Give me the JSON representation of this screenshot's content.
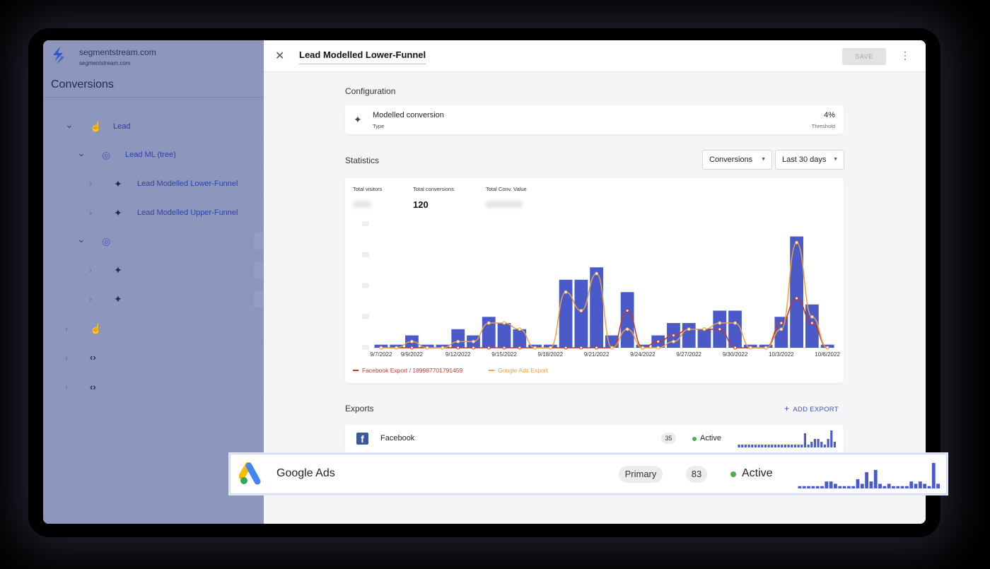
{
  "sidebar": {
    "site_name": "segmentstream.com",
    "site_sub": "segmentstream.com",
    "heading": "Conversions",
    "tree": [
      {
        "label": "Lead",
        "icon": "hand-pointer-icon",
        "level": 0,
        "chevron": "down"
      },
      {
        "label": "Lead ML (tree)",
        "icon": "ml-target-icon",
        "level": 1,
        "chevron": "down"
      },
      {
        "label": "Lead Modelled Lower-Funnel",
        "icon": "sparkle-icon",
        "level": 2,
        "chevron": "right"
      },
      {
        "label": "Lead Modelled Upper-Funnel",
        "icon": "sparkle-icon",
        "level": 2,
        "chevron": "right"
      },
      {
        "label": "",
        "icon": "ml-target-icon",
        "level": 1,
        "chevron": "down"
      },
      {
        "label": "",
        "icon": "sparkle-icon",
        "level": 2,
        "chevron": "right"
      },
      {
        "label": "",
        "icon": "sparkle-icon",
        "level": 2,
        "chevron": "right"
      },
      {
        "label": "",
        "icon": "hand-pointer-icon",
        "level": 0,
        "chevron": "right"
      },
      {
        "label": "",
        "icon": "code-icon",
        "level": 0,
        "chevron": "right"
      },
      {
        "label": "",
        "icon": "code-icon",
        "level": 0,
        "chevron": "right"
      }
    ]
  },
  "panel": {
    "title": "Lead Modelled Lower-Funnel",
    "save_label": "SAVE",
    "close_icon": "close-icon",
    "more_icon": "more-vertical-icon"
  },
  "configuration": {
    "section_title": "Configuration",
    "name": "Modelled conversion",
    "type_label": "Type",
    "value": "4%",
    "value_label": "Threshold"
  },
  "statistics": {
    "section_title": "Statistics",
    "metric_select": "Conversions",
    "range_select": "Last 30 days",
    "kpis": [
      {
        "label": "Total visitors",
        "value": ""
      },
      {
        "label": "Total conversions",
        "value": "120"
      },
      {
        "label": "Total Conv. Value",
        "value": ""
      }
    ]
  },
  "chart_data": {
    "type": "bar",
    "title": "",
    "xlabel": "",
    "ylabel": "",
    "categories": [
      "9/7/2022",
      "9/8/2022",
      "9/9/2022",
      "9/10/2022",
      "9/11/2022",
      "9/12/2022",
      "9/13/2022",
      "9/14/2022",
      "9/15/2022",
      "9/16/2022",
      "9/17/2022",
      "9/18/2022",
      "9/19/2022",
      "9/20/2022",
      "9/21/2022",
      "9/22/2022",
      "9/23/2022",
      "9/24/2022",
      "9/25/2022",
      "9/26/2022",
      "9/27/2022",
      "9/28/2022",
      "9/29/2022",
      "9/30/2022",
      "10/1/2022",
      "10/2/2022",
      "10/3/2022",
      "10/4/2022",
      "10/5/2022",
      "10/6/2022"
    ],
    "tick_labels": [
      "9/7/2022",
      "9/9/2022",
      "9/12/2022",
      "9/15/2022",
      "9/18/2022",
      "9/21/2022",
      "9/24/2022",
      "9/27/2022",
      "9/30/2022",
      "10/3/2022",
      "10/6/2022"
    ],
    "ylim": [
      0,
      20
    ],
    "series": [
      {
        "kind": "bar",
        "color": "#4a5bc9",
        "values": [
          0.5,
          0.5,
          2,
          0.5,
          0.5,
          3,
          2,
          5,
          4,
          3,
          0.5,
          0.5,
          11,
          11,
          13,
          2,
          9,
          0.5,
          2,
          4,
          4,
          3,
          6,
          6,
          0.5,
          0.5,
          5,
          18,
          7,
          0.5
        ]
      },
      {
        "name": "Facebook Export / 189987701791459",
        "kind": "line",
        "color": "#c0392b",
        "values": [
          0,
          0,
          0,
          0,
          0,
          0,
          0,
          0,
          0,
          0,
          0,
          0,
          0,
          0,
          0,
          0,
          6,
          0,
          1,
          2,
          3,
          3,
          3,
          0,
          0,
          0,
          4,
          8,
          4,
          0
        ]
      },
      {
        "name": "Google Ads Export",
        "kind": "line",
        "color": "#f0a040",
        "values": [
          0,
          0,
          1,
          0,
          0,
          1,
          1,
          4,
          4,
          3,
          0,
          0,
          9,
          6,
          12,
          0,
          3,
          0,
          0,
          1,
          3,
          3,
          4,
          4,
          0,
          0,
          3,
          17,
          5,
          0
        ]
      }
    ],
    "grid": false,
    "legend_position": "bottom-left"
  },
  "exports": {
    "section_title": "Exports",
    "add_label": "ADD EXPORT",
    "rows": [
      {
        "name": "Facebook",
        "count": "35",
        "status": "Active",
        "spark": [
          1,
          1,
          1,
          1,
          1,
          1,
          1,
          1,
          1,
          1,
          1,
          1,
          1,
          1,
          1,
          1,
          1,
          1,
          1,
          1,
          5,
          1,
          2,
          3,
          3,
          2,
          1,
          3,
          6,
          2
        ]
      },
      {
        "name": "Google Ads",
        "tag": "Primary",
        "count": "83",
        "status": "Active",
        "spark": [
          1,
          1,
          1,
          1,
          1,
          1,
          3,
          3,
          2,
          1,
          1,
          1,
          1,
          4,
          2,
          7,
          3,
          8,
          2,
          1,
          2,
          1,
          1,
          1,
          1,
          3,
          2,
          3,
          2,
          1,
          11,
          2
        ]
      }
    ]
  },
  "colors": {
    "accent": "#3f51b5",
    "active": "#4caf50",
    "bar": "#4a5bc9",
    "sidebar": "#8d96bd"
  }
}
